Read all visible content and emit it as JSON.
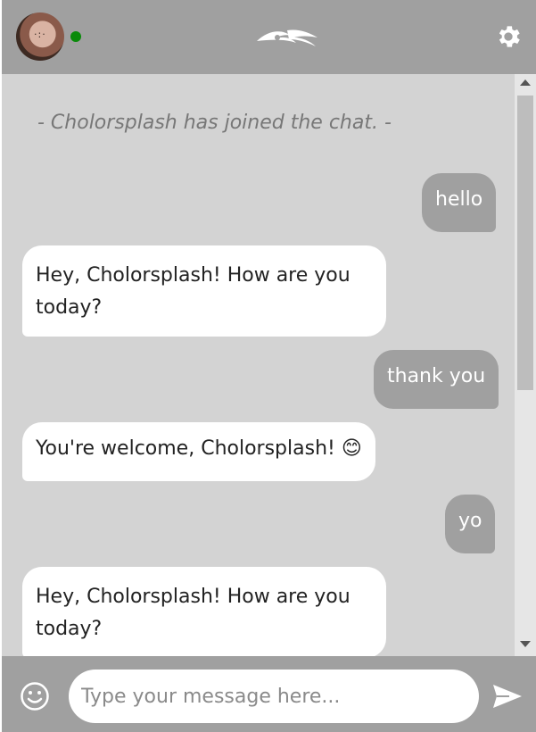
{
  "header": {
    "avatar_icon": "user-avatar",
    "status": "online",
    "status_color": "#0a8a0a",
    "logo_icon": "brand-logo",
    "settings_icon": "gear-icon"
  },
  "chat": {
    "system_message": "- Cholorsplash has joined the chat. -",
    "messages": [
      {
        "from": "user",
        "text": "hello"
      },
      {
        "from": "bot",
        "text": "Hey, Cholorsplash! How are you today?"
      },
      {
        "from": "user",
        "text": "thank you"
      },
      {
        "from": "bot",
        "text": "You're welcome, Cholorsplash! 😊"
      },
      {
        "from": "user",
        "text": "yo"
      },
      {
        "from": "bot",
        "text": "Hey, Cholorsplash! How are you today?"
      }
    ]
  },
  "composer": {
    "emoji_icon": "smiley-icon",
    "placeholder": "Type your message here...",
    "value": "",
    "send_icon": "send-icon"
  },
  "colors": {
    "header_bg": "#a0a0a0",
    "chat_bg": "#d3d3d3",
    "outgoing_bubble": "#a0a0a0",
    "incoming_bubble": "#ffffff"
  }
}
